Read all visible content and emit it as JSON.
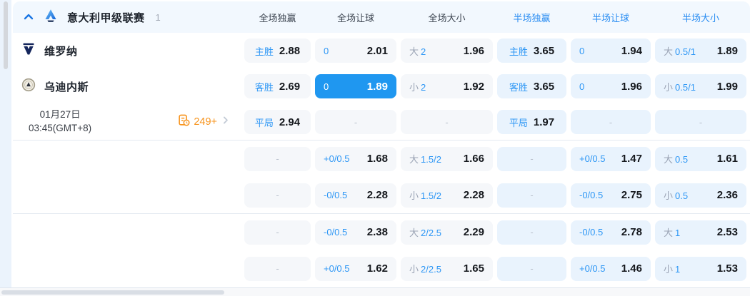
{
  "header": {
    "league_name": "意大利甲级联赛",
    "match_count": "1",
    "columns": [
      {
        "label": "全场独赢"
      },
      {
        "label": "全场让球"
      },
      {
        "label": "全场大小"
      },
      {
        "label": "半场独赢"
      },
      {
        "label": "半场让球"
      },
      {
        "label": "半场大小"
      }
    ]
  },
  "match": {
    "home_team": "维罗纳",
    "away_team": "乌迪内斯",
    "date": "01月27日",
    "time": "03:45(GMT+8)",
    "more_markets": "249+"
  },
  "icons": {
    "collapse": "chevron-up-icon",
    "league": "serie-a-logo",
    "home": "verona-crest",
    "away": "udinese-crest",
    "markets": "records-clock-icon",
    "more": "chevron-right-icon"
  },
  "colors": {
    "accent_blue": "#2e97f5",
    "half_header_blue": "#2a8df2",
    "highlight_cell_bg": "#1f97f0",
    "orange": "#f7941d",
    "muted_gray": "#9aa3b4"
  },
  "rows": [
    {
      "cells": [
        {
          "label": "主胜",
          "value": "2.88"
        },
        {
          "label": "0",
          "value": "2.01"
        },
        {
          "muted": "大",
          "line": "2",
          "value": "1.96"
        },
        {
          "label": "主胜",
          "value": "3.65"
        },
        {
          "label": "0",
          "value": "1.94"
        },
        {
          "muted": "大",
          "line": "0.5/1",
          "value": "1.89"
        }
      ]
    },
    {
      "cells": [
        {
          "label": "客胜",
          "value": "2.69"
        },
        {
          "label": "0",
          "value": "1.89"
        },
        {
          "muted": "小",
          "line": "2",
          "value": "1.92"
        },
        {
          "label": "客胜",
          "value": "3.65"
        },
        {
          "label": "0",
          "value": "1.96"
        },
        {
          "muted": "小",
          "line": "0.5/1",
          "value": "1.99"
        }
      ]
    },
    {
      "cells": [
        {
          "label": "平局",
          "value": "2.94"
        },
        {
          "dash": "-"
        },
        {
          "dash": "-"
        },
        {
          "label": "平局",
          "value": "1.97"
        },
        {
          "dash": "-"
        },
        {
          "dash": "-"
        }
      ]
    },
    {
      "cells": [
        {
          "dash": "-"
        },
        {
          "label": "+0/0.5",
          "value": "1.68"
        },
        {
          "muted": "大",
          "line": "1.5/2",
          "value": "1.66"
        },
        {
          "dash": "-"
        },
        {
          "label": "+0/0.5",
          "value": "1.47"
        },
        {
          "muted": "大",
          "line": "0.5",
          "value": "1.61"
        }
      ]
    },
    {
      "cells": [
        {
          "dash": "-"
        },
        {
          "label": "-0/0.5",
          "value": "2.28"
        },
        {
          "muted": "小",
          "line": "1.5/2",
          "value": "2.28"
        },
        {
          "dash": "-"
        },
        {
          "label": "-0/0.5",
          "value": "2.75"
        },
        {
          "muted": "小",
          "line": "0.5",
          "value": "2.36"
        }
      ]
    },
    {
      "cells": [
        {
          "dash": "-"
        },
        {
          "label": "-0/0.5",
          "value": "2.38"
        },
        {
          "muted": "大",
          "line": "2/2.5",
          "value": "2.29"
        },
        {
          "dash": "-"
        },
        {
          "label": "-0/0.5",
          "value": "2.78"
        },
        {
          "muted": "大",
          "line": "1",
          "value": "2.53"
        }
      ]
    },
    {
      "cells": [
        {
          "dash": "-"
        },
        {
          "label": "+0/0.5",
          "value": "1.62"
        },
        {
          "muted": "小",
          "line": "2/2.5",
          "value": "1.65"
        },
        {
          "dash": "-"
        },
        {
          "label": "+0/0.5",
          "value": "1.46"
        },
        {
          "muted": "小",
          "line": "1",
          "value": "1.53"
        }
      ]
    }
  ]
}
